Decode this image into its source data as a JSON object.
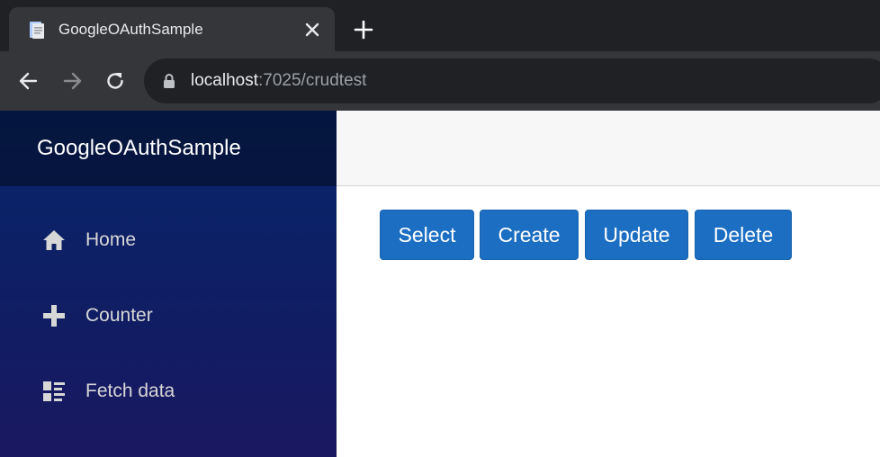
{
  "browser": {
    "tab_title": "GoogleOAuthSample",
    "url_host": "localhost",
    "url_rest": ":7025/crudtest",
    "icons": {
      "favicon": "page-icon",
      "close": "close-icon",
      "new_tab": "plus-icon",
      "back": "arrow-left-icon",
      "forward": "arrow-right-icon",
      "reload": "reload-icon",
      "lock": "lock-icon"
    }
  },
  "sidebar": {
    "brand": "GoogleOAuthSample",
    "items": [
      {
        "label": "Home",
        "icon": "home-icon"
      },
      {
        "label": "Counter",
        "icon": "plus-icon"
      },
      {
        "label": "Fetch data",
        "icon": "list-icon"
      }
    ]
  },
  "main": {
    "buttons": [
      "Select",
      "Create",
      "Update",
      "Delete"
    ]
  },
  "colors": {
    "primary_button": "#1b6ec2",
    "sidebar_top": "#052767",
    "topbar": "#f7f7f7"
  }
}
